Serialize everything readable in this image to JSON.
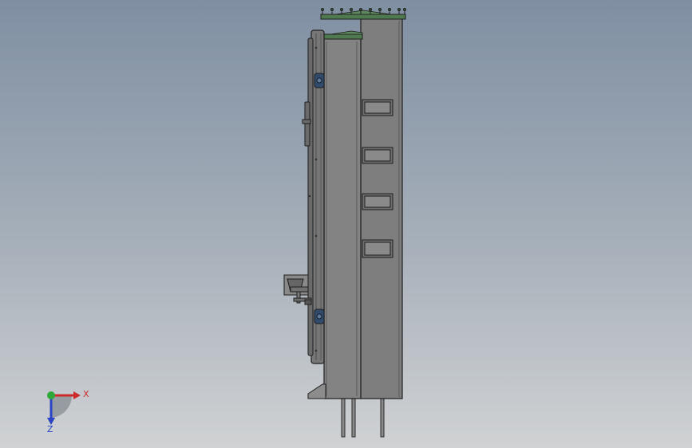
{
  "viewport": {
    "background_top": "#7f8fa2",
    "background_bottom": "#d0d2d4"
  },
  "colors": {
    "body_fill": "#808080",
    "body_edge": "#1e1e1e",
    "door_fill": "#767676",
    "top_cap": "#4f7a4f",
    "hinge": "#2f4a6a",
    "axis_x": "#cc2a2a",
    "axis_y": "#2fa83a",
    "axis_z": "#2a44c4"
  },
  "triad": {
    "x_label": "X",
    "z_label": "Z",
    "x_icon": "x-axis-arrow-icon",
    "y_icon": "y-axis-dot-icon",
    "z_icon": "z-axis-arrow-icon"
  }
}
